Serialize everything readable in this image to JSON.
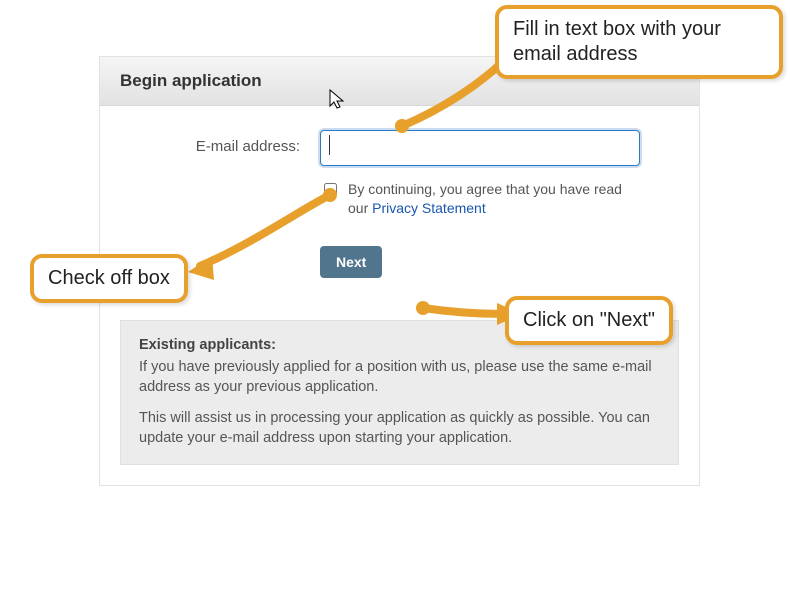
{
  "panel": {
    "title": "Begin application",
    "email_label": "E-mail address:",
    "email_value": "",
    "email_placeholder": "",
    "consent_prefix": "By continuing, you agree that you have read our ",
    "consent_link": "Privacy Statement",
    "next_label": "Next"
  },
  "note": {
    "title": "Existing applicants:",
    "p1": "If you have previously applied for a position with us, please use the same e-mail address as your previous application.",
    "p2": "This will assist us in processing your application as quickly as possible. You can update your e-mail address upon starting your application."
  },
  "callouts": {
    "email": "Fill in text box with your email address",
    "checkbox": "Check off box",
    "next": "Click on \"Next\""
  }
}
